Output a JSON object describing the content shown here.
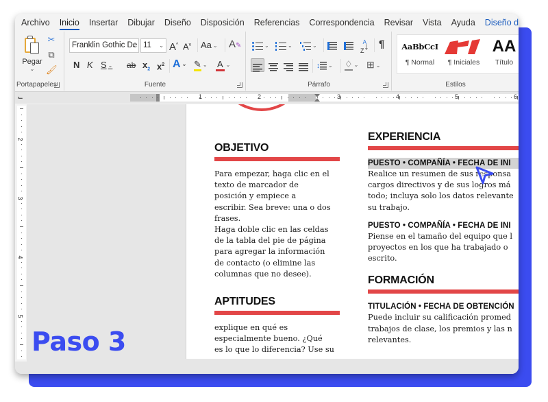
{
  "tabs": [
    {
      "label": "Archivo",
      "active": false
    },
    {
      "label": "Inicio",
      "active": true
    },
    {
      "label": "Insertar",
      "active": false
    },
    {
      "label": "Dibujar",
      "active": false
    },
    {
      "label": "Diseño",
      "active": false
    },
    {
      "label": "Disposición",
      "active": false
    },
    {
      "label": "Referencias",
      "active": false
    },
    {
      "label": "Correspondencia",
      "active": false
    },
    {
      "label": "Revisar",
      "active": false
    },
    {
      "label": "Vista",
      "active": false
    },
    {
      "label": "Ayuda",
      "active": false
    },
    {
      "label": "Diseño d",
      "active": false
    }
  ],
  "ribbon": {
    "clipboard": {
      "label": "Portapapeles",
      "paste_label": "Pegar",
      "icons": [
        "cut-icon",
        "copy-icon",
        "format-painter-icon"
      ]
    },
    "font": {
      "label": "Fuente",
      "font_name": "Franklin Gothic De",
      "font_size": "11",
      "grow": "A",
      "shrink": "A",
      "change_case": "Aa",
      "bold": "N",
      "italic": "K",
      "underline": "S",
      "strike": "ab",
      "subscript": "x",
      "superscript": "x",
      "text_effects": "A",
      "font_color": "A",
      "highlight_color": "#f5e400",
      "font_color_value": "#d13438"
    },
    "paragraph": {
      "label": "Párrafo",
      "sort": "A↓",
      "pilcrow": "¶"
    },
    "styles": {
      "label": "Estilos",
      "items": [
        {
          "sample": "AaBbCcI",
          "name": "¶ Normal"
        },
        {
          "sample": "",
          "name": "¶ Iniciales"
        },
        {
          "sample": "AA",
          "name": "Título"
        }
      ]
    }
  },
  "ruler": {
    "horizontal_numbers": [
      "1",
      "2",
      "3",
      "4",
      "5",
      "6"
    ],
    "vertical_numbers": [
      "2",
      "3",
      "4",
      "5"
    ]
  },
  "document": {
    "left": {
      "objetivo_heading": "OBJETIVO",
      "objetivo_lines": [
        "Para empezar, haga clic en el",
        "texto de marcador de",
        "posición y empiece a",
        "escribir. Sea breve: una o dos",
        "frases.",
        "Haga doble clic en las celdas",
        "de la tabla del pie de página",
        "para agregar la información",
        "de contacto (o elimine las",
        "columnas que no desee)."
      ],
      "aptitudes_heading": "APTITUDES",
      "aptitudes_lines": [
        "explique en qué es",
        "especialmente bueno. ¿Qué",
        "es lo que lo diferencia? Use su"
      ]
    },
    "right": {
      "experiencia_heading": "EXPERIENCIA",
      "job1_title": "PUESTO • COMPAÑÍA • FECHA DE INI",
      "job1_lines": [
        "Realice un resumen de sus responsa",
        "cargos directivos y de sus logros má",
        "todo; incluya solo los datos relevante",
        "su trabajo."
      ],
      "job2_title": "PUESTO • COMPAÑÍA • FECHA DE INI",
      "job2_lines": [
        "Piense en el tamaño del equipo que l",
        "proyectos en los que ha trabajado o",
        "escrito."
      ],
      "formacion_heading": "FORMACIÓN",
      "edu_title": "TITULACIÓN • FECHA DE OBTENCIÓN",
      "edu_lines": [
        "Puede incluir su calificación promed",
        "trabajos de clase, los premios y las n",
        "relevantes."
      ]
    }
  },
  "overlay": {
    "step_label": "Paso 3",
    "accent_color": "#3b4cf0",
    "heading_bar_color": "#e24647"
  }
}
